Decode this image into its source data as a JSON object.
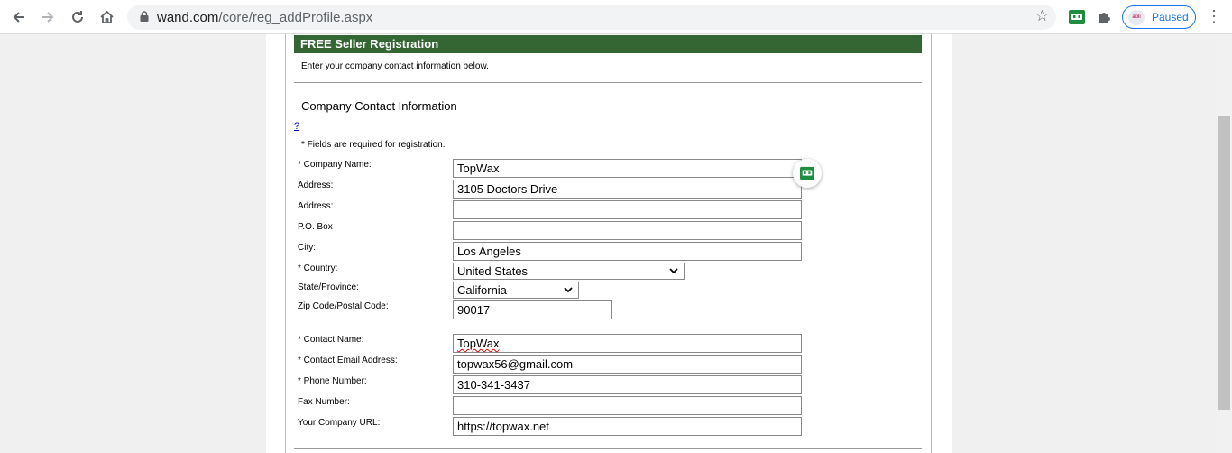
{
  "browser": {
    "url_domain": "wand.com",
    "url_path": "/core/reg_addProfile.aspx",
    "profile_label": "Paused"
  },
  "page": {
    "banner": "FREE Seller Registration",
    "intro": "Enter your company contact information below.",
    "section_title": "Company Contact Information",
    "help_link": "?",
    "required_note": "* Fields are required for registration."
  },
  "form": {
    "company_name": {
      "label": "* Company Name:",
      "value": "TopWax"
    },
    "address1": {
      "label": "Address:",
      "value": "3105  Doctors Drive"
    },
    "address2": {
      "label": "Address:",
      "value": ""
    },
    "po_box": {
      "label": "P.O. Box",
      "value": ""
    },
    "city": {
      "label": "City:",
      "value": "Los Angeles"
    },
    "country": {
      "label": "* Country:",
      "value": "United States"
    },
    "state": {
      "label": "State/Province:",
      "value": "California"
    },
    "zip": {
      "label": "Zip Code/Postal Code:",
      "value": "90017"
    },
    "contact_name": {
      "label": "* Contact Name:",
      "value": "TopWax"
    },
    "contact_email": {
      "label": "* Contact Email Address:",
      "value": "topwax56@gmail.com"
    },
    "phone": {
      "label": "* Phone Number:",
      "value": "310-341-3437"
    },
    "fax": {
      "label": "Fax Number:",
      "value": ""
    },
    "company_url": {
      "label": "Your Company URL:",
      "value": "https://topwax.net"
    }
  },
  "icons": {
    "back": "arrow-left-icon",
    "forward": "arrow-right-icon",
    "reload": "reload-icon",
    "home": "home-icon",
    "lock": "lock-icon",
    "bookmark": "star-icon",
    "extension_green": "robot-face-icon",
    "extensions": "puzzle-icon",
    "menu": "more-vertical-icon"
  },
  "colors": {
    "banner": "#336633",
    "link": "#0000cc",
    "accent": "#1a73e8"
  }
}
